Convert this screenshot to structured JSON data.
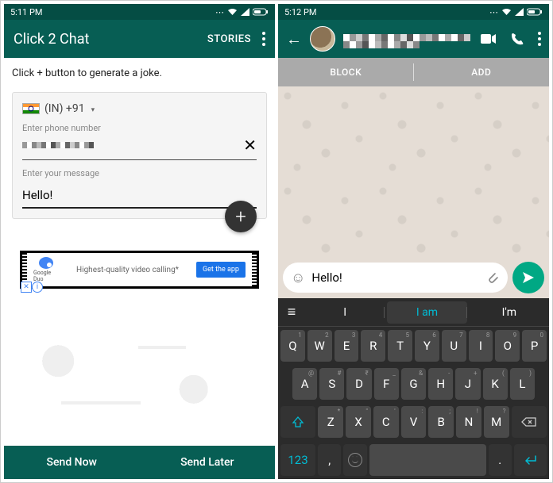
{
  "left": {
    "status_time": "5:11 PM",
    "app_title": "Click 2 Chat",
    "stories_label": "STORIES",
    "hint": "Click + button to generate a joke.",
    "country_code": "(IN)  +91",
    "phone_label": "Enter phone number",
    "phone_value_censored": true,
    "msg_label": "Enter your message",
    "msg_value": "Hello!",
    "ad_brand": "Google Duo",
    "ad_text": "Highest-quality video calling*",
    "ad_cta": "Get the app",
    "send_now": "Send Now",
    "send_later": "Send Later"
  },
  "right": {
    "status_time": "5:12 PM",
    "contact_name_censored": true,
    "block_label": "BLOCK",
    "add_label": "ADD",
    "input_value": "Hello!",
    "suggestions": [
      "I",
      "I am",
      "I'm"
    ],
    "keys_row1": [
      {
        "k": "Q",
        "s": "1"
      },
      {
        "k": "W",
        "s": "2"
      },
      {
        "k": "E",
        "s": "3"
      },
      {
        "k": "R",
        "s": "4"
      },
      {
        "k": "T",
        "s": "5"
      },
      {
        "k": "Y",
        "s": "6"
      },
      {
        "k": "U",
        "s": "7"
      },
      {
        "k": "I",
        "s": "8"
      },
      {
        "k": "O",
        "s": "9"
      },
      {
        "k": "P",
        "s": "0"
      }
    ],
    "keys_row2": [
      {
        "k": "A",
        "s": "@"
      },
      {
        "k": "S",
        "s": "#"
      },
      {
        "k": "D",
        "s": "₹"
      },
      {
        "k": "F",
        "s": "_"
      },
      {
        "k": "G",
        "s": "&"
      },
      {
        "k": "H",
        "s": "-"
      },
      {
        "k": "J",
        "s": "+"
      },
      {
        "k": "K",
        "s": "("
      },
      {
        "k": "L",
        "s": ")"
      }
    ],
    "keys_row3": [
      {
        "k": "Z",
        "s": "*"
      },
      {
        "k": "X",
        "s": "\""
      },
      {
        "k": "C",
        "s": "'"
      },
      {
        "k": "V",
        "s": ":"
      },
      {
        "k": "B",
        "s": ";"
      },
      {
        "k": "N",
        "s": "!"
      },
      {
        "k": "M",
        "s": "?"
      }
    ],
    "num_key": "123",
    "comma_key": ",",
    "period_key": "."
  }
}
